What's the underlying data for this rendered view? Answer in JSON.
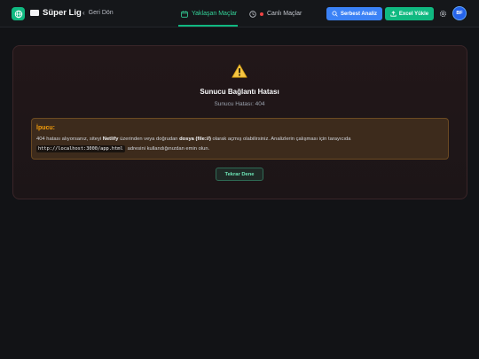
{
  "header": {
    "brand": "Süper Lig",
    "back_label": "Geri Dön",
    "tabs": [
      {
        "label": "Yaklaşan Maçlar",
        "active": true
      },
      {
        "label": "Canlı Maçlar",
        "active": false
      }
    ],
    "analyze_label": "Serbest Analiz",
    "upload_label": "Excel Yükle",
    "avatar_initials": "BF"
  },
  "error": {
    "title": "Sunucu Bağlantı Hatası",
    "subtitle": "Sunucu Hatası: 404",
    "tip_title": "İpucu:",
    "tip_text_1": "404 hatası alıyorsanız, siteyi ",
    "tip_bold_1": "Netlify",
    "tip_text_2": " üzerinden veya doğrudan ",
    "tip_bold_2": "dosya (file://)",
    "tip_text_3": " olarak açmış olabilirsiniz. Analizlerin çalışması için tarayıcıda",
    "tip_code": "http://localhost:3000/app.html",
    "tip_text_4": " adresini kullandığınızdan emin olun.",
    "retry_label": "Tekrar Dene"
  },
  "colors": {
    "accent_green": "#10b981",
    "accent_blue": "#3b82f6",
    "warning": "#f59e0b",
    "background": "#121316"
  },
  "icons": [
    "globe-icon",
    "flag-icon",
    "chevron-left-icon",
    "calendar-icon",
    "clock-icon",
    "search-icon",
    "upload-icon",
    "gear-icon",
    "warning-icon"
  ]
}
